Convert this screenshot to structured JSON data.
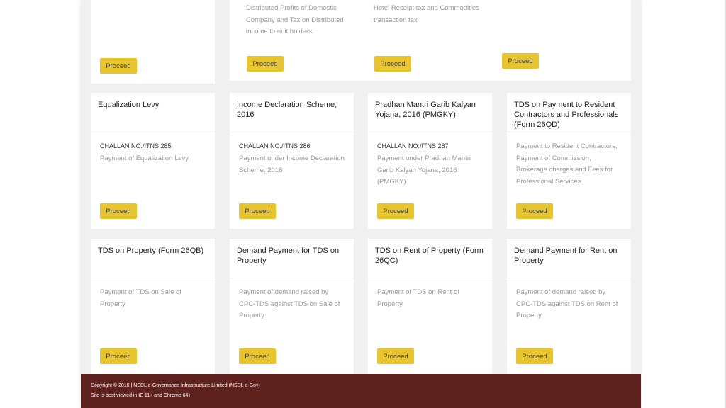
{
  "top_row": [
    {
      "description": "",
      "button": "Proceed"
    },
    {
      "description_lines": [
        "Distributed Profits of Domestic",
        "Company and Tax on Distributed",
        "income to unit holders."
      ],
      "button": "Proceed"
    },
    {
      "description_lines": [
        "Hotel Receipt tax and Commodities",
        "transaction tax"
      ],
      "button": "Proceed"
    },
    {
      "description": "",
      "button": "Proceed"
    }
  ],
  "cards": [
    {
      "title": "Equalization Levy",
      "challan": "CHALLAN NO./ITNS 285",
      "description": "Payment of Equalization Levy",
      "button": "Proceed"
    },
    {
      "title": "Income Declaration Scheme, 2016",
      "challan": "CHALLAN NO./ITNS 286",
      "description": "Payment under Income Declaration Scheme, 2016",
      "button": "Proceed"
    },
    {
      "title": "Pradhan Mantri Garib Kalyan Yojana, 2016 (PMGKY)",
      "challan": "CHALLAN NO./ITNS 287",
      "description": "Payment under Pradhan Mantri Garib Kalyan Yojana, 2016 (PMGKY)",
      "button": "Proceed"
    },
    {
      "title": "TDS on Payment to Resident Contractors and Professionals (Form 26QD)",
      "challan": "",
      "description": "Payment to Resident Contractors, Payment of Commission, Brokerage charges and Fees for Professional Services.",
      "button": "Proceed"
    },
    {
      "title": "TDS on Property (Form 26QB)",
      "challan": "",
      "description": "Payment of TDS on Sale of Property",
      "button": "Proceed"
    },
    {
      "title": "Demand Payment for TDS on Property",
      "challan": "",
      "description": "Payment of demand raised by CPC-TDS against TDS on Sale of Property",
      "button": "Proceed"
    },
    {
      "title": "TDS on Rent of Property (Form 26QC)",
      "challan": "",
      "description": "Payment of TDS on Rent of Property",
      "button": "Proceed"
    },
    {
      "title": "Demand Payment for Rent on Property",
      "challan": "",
      "description": "Payment of demand raised by CPC-TDS against TDS on Rent of Property",
      "button": "Proceed"
    }
  ],
  "footer": {
    "copyright": "Copyright © 2010 | NSDL e-Governance Infrastructure Limited (NSDL e-Gov)",
    "browser_note": "Site is best viewed in IE 11+ and Chrome 64+"
  },
  "colors": {
    "button": "#e9c52d",
    "footer": "#5e221e"
  }
}
